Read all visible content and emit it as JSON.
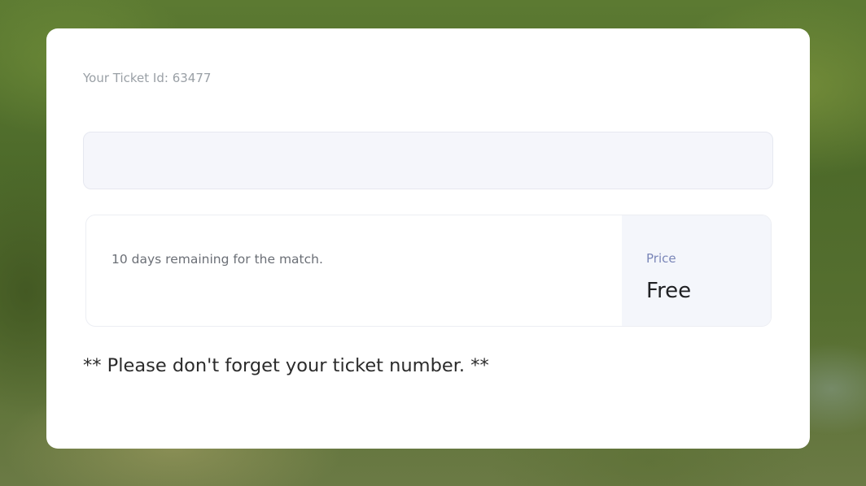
{
  "ticket": {
    "id_label": "Your Ticket Id: 63477"
  },
  "ticket_input": {
    "value": "",
    "placeholder": ""
  },
  "match": {
    "remaining_text": "10 days remaining for the match."
  },
  "price": {
    "label": "Price",
    "value": "Free"
  },
  "reminder": {
    "text": "** Please don't forget your ticket number. **"
  }
}
